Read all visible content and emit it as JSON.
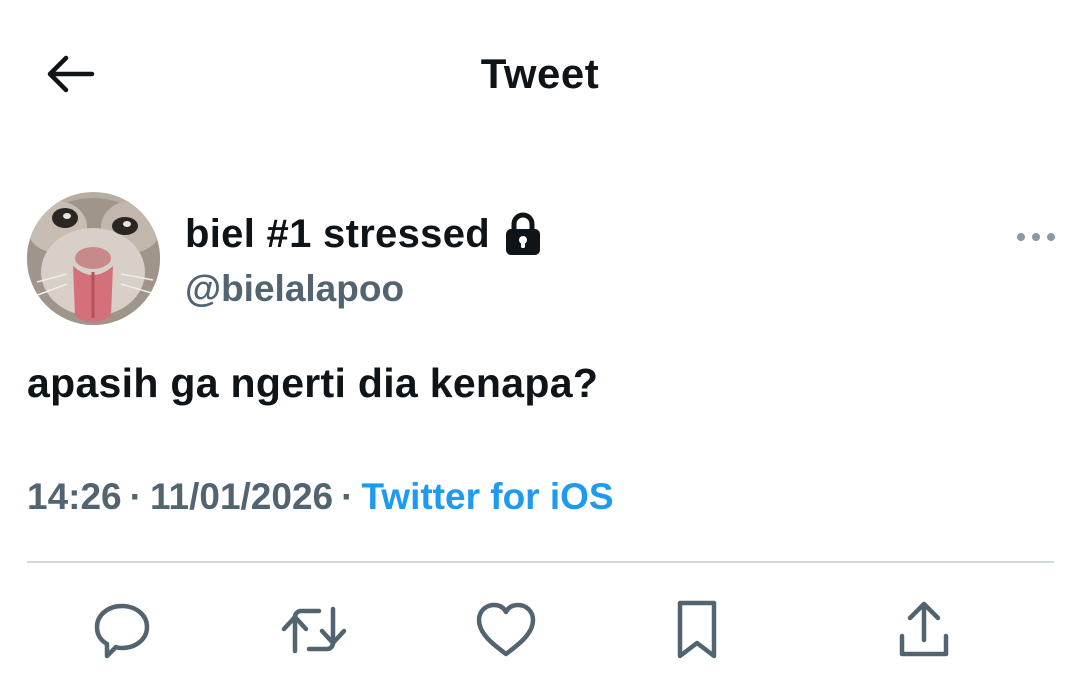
{
  "header": {
    "title": "Tweet",
    "back_icon": "arrow-left-icon"
  },
  "author": {
    "display_name": "biel #1 stressed",
    "handle": "@bielalapoo",
    "protected_icon": "lock-icon",
    "avatar": "cat-with-tongue-out-avatar"
  },
  "more_icon": "more-dots-icon",
  "tweet": {
    "text": "apasih ga ngerti dia kenapa?"
  },
  "meta": {
    "time": "14:26",
    "separator": "·",
    "date": "11/01/2026",
    "source": "Twitter for iOS"
  },
  "actions": [
    {
      "name": "reply",
      "icon": "reply-icon"
    },
    {
      "name": "retweet",
      "icon": "retweet-icon"
    },
    {
      "name": "like",
      "icon": "heart-icon"
    },
    {
      "name": "bookmark",
      "icon": "bookmark-icon"
    },
    {
      "name": "share",
      "icon": "share-icon"
    }
  ],
  "colors": {
    "text": "#0f1419",
    "secondary": "#536471",
    "link": "#1d9bf0",
    "divider": "#cfd9de"
  }
}
